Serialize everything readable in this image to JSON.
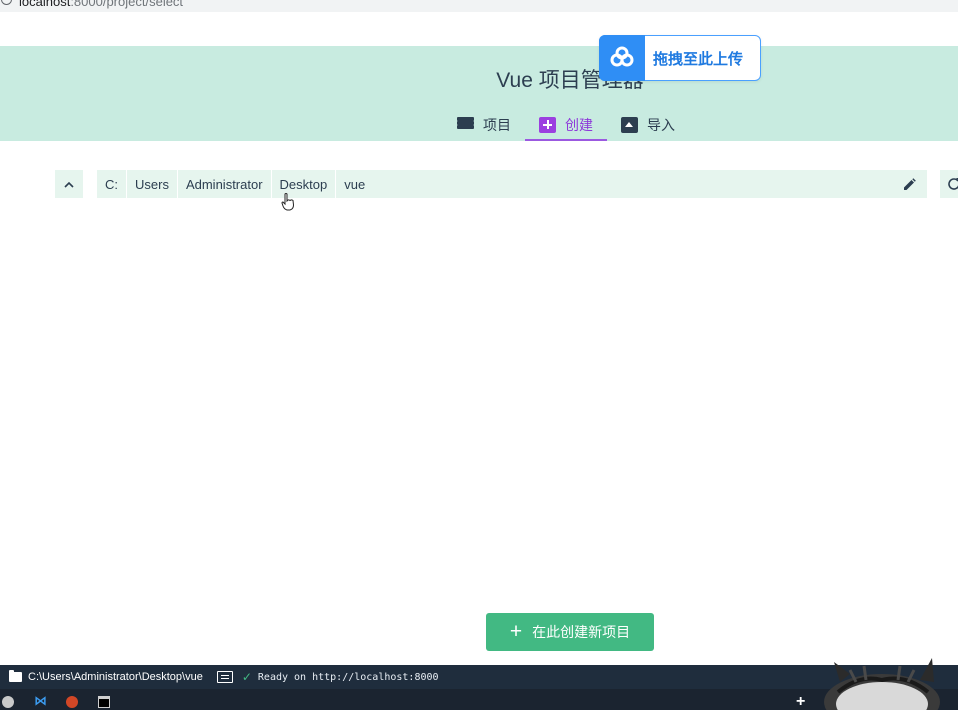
{
  "browser": {
    "url_host": "localhost",
    "url_path": ":8000/project/select"
  },
  "header": {
    "title": "Vue 项目管理器",
    "tabs": [
      {
        "label": "项目",
        "icon": "list-icon"
      },
      {
        "label": "创建",
        "icon": "add-box-icon",
        "active": true
      },
      {
        "label": "导入",
        "icon": "unarchive-icon"
      }
    ]
  },
  "upload_badge": {
    "label": "拖拽至此上传",
    "icon": "baidu-netdisk-cloud-icon",
    "color": "#2f8ef5"
  },
  "path_bar": {
    "up_icon": "chevron-up-icon",
    "crumbs": [
      "C:",
      "Users",
      "Administrator",
      "Desktop",
      "vue"
    ],
    "edit_icon": "pencil-icon",
    "refresh_icon": "refresh-icon"
  },
  "create_button": {
    "label": "在此创建新项目",
    "color": "#42b983"
  },
  "status_bar": {
    "cwd": "C:\\Users\\Administrator\\Desktop\\vue",
    "status": "Ready on http://localhost:8000"
  },
  "taskbar": {
    "apps": [
      "chrome-icon",
      "vscode-icon",
      "powerpoint-icon",
      "terminal-icon"
    ]
  },
  "colors": {
    "header_bg": "#c8ebe0",
    "accent": "#42b983",
    "active_tab": "#8e3ad9",
    "text": "#2c3e50"
  }
}
